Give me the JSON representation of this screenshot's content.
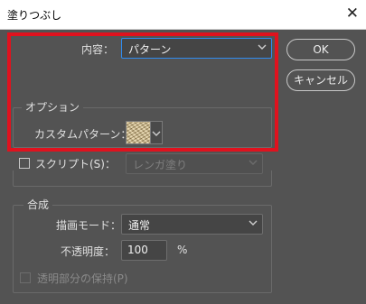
{
  "window": {
    "title": "塗りつぶし",
    "close_glyph": "✕"
  },
  "contents": {
    "label": "内容：",
    "value": "パターン"
  },
  "buttons": {
    "ok": "OK",
    "cancel": "キャンセル"
  },
  "options": {
    "legend": "オプション",
    "custom_pattern_label": "カスタムパターン："
  },
  "script": {
    "checkbox_label": "スクリプト(S)：",
    "value": "レンガ塗り",
    "checked": false
  },
  "blend": {
    "legend": "合成",
    "mode_label": "描画モード：",
    "mode_value": "通常",
    "opacity_label": "不透明度：",
    "opacity_value": "100",
    "opacity_unit": "%",
    "preserve_label": "透明部分の保持(P)",
    "preserve_checked": false
  },
  "colors": {
    "background": "#535353",
    "highlight_frame": "#e0121e",
    "focus_border": "#2f8cf0"
  }
}
